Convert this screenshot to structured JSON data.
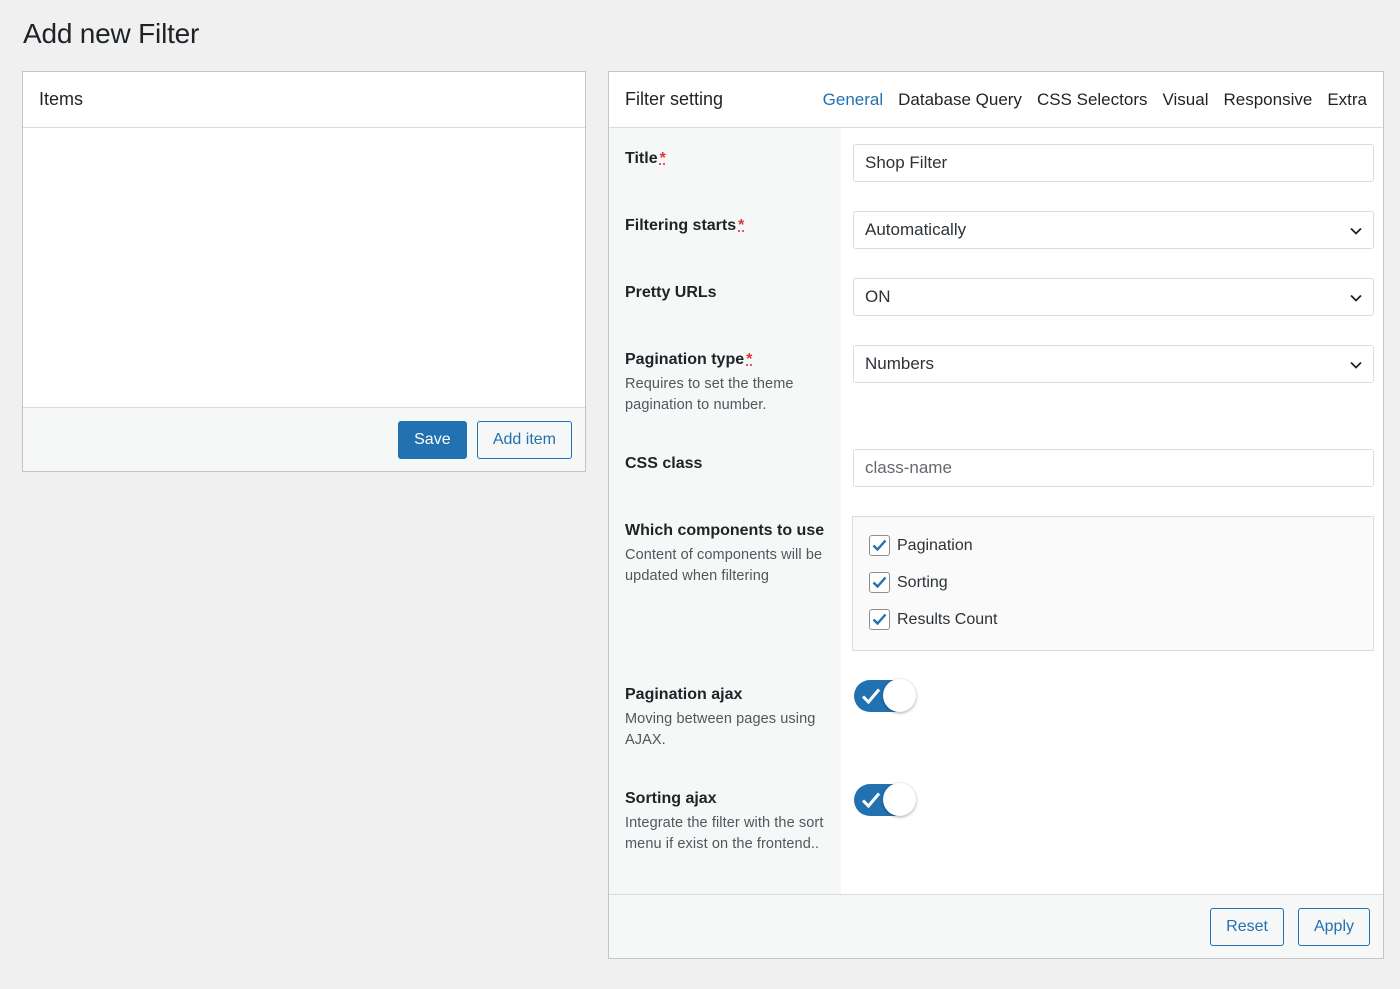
{
  "page": {
    "title": "Add new Filter"
  },
  "items_panel": {
    "title": "Items",
    "save_label": "Save",
    "add_item_label": "Add item"
  },
  "settings": {
    "title": "Filter setting",
    "tabs": [
      {
        "label": "General",
        "active": true
      },
      {
        "label": "Database Query",
        "active": false
      },
      {
        "label": "CSS Selectors",
        "active": false
      },
      {
        "label": "Visual",
        "active": false
      },
      {
        "label": "Responsive",
        "active": false
      },
      {
        "label": "Extra",
        "active": false
      }
    ],
    "fields": {
      "title": {
        "label": "Title",
        "required_mark": "*",
        "value": "Shop Filter"
      },
      "filtering_starts": {
        "label": "Filtering starts",
        "required_mark": "*",
        "value": "Automatically"
      },
      "pretty_urls": {
        "label": "Pretty URLs",
        "value": "ON"
      },
      "pagination_type": {
        "label": "Pagination type",
        "required_mark": "*",
        "description": "Requires to set the theme pagination to number.",
        "value": "Numbers"
      },
      "css_class": {
        "label": "CSS class",
        "value": "",
        "placeholder": "class-name"
      },
      "components": {
        "label": "Which components to use",
        "description": "Content of components will be updated when filtering",
        "options": [
          {
            "label": "Pagination",
            "checked": true
          },
          {
            "label": "Sorting",
            "checked": true
          },
          {
            "label": "Results Count",
            "checked": true
          }
        ]
      },
      "pagination_ajax": {
        "label": "Pagination ajax",
        "description": "Moving between pages using AJAX.",
        "enabled": true
      },
      "sorting_ajax": {
        "label": "Sorting ajax",
        "description": "Integrate the filter with the sort menu if exist on the frontend..",
        "enabled": true
      }
    },
    "reset_label": "Reset",
    "apply_label": "Apply"
  },
  "colors": {
    "accent": "#2271b1",
    "required": "#d63638",
    "background": "#f0f0f1"
  },
  "icons": {
    "select": "chevron-down-icon",
    "checkbox": "checkmark-icon",
    "toggle": "checkmark-icon"
  }
}
